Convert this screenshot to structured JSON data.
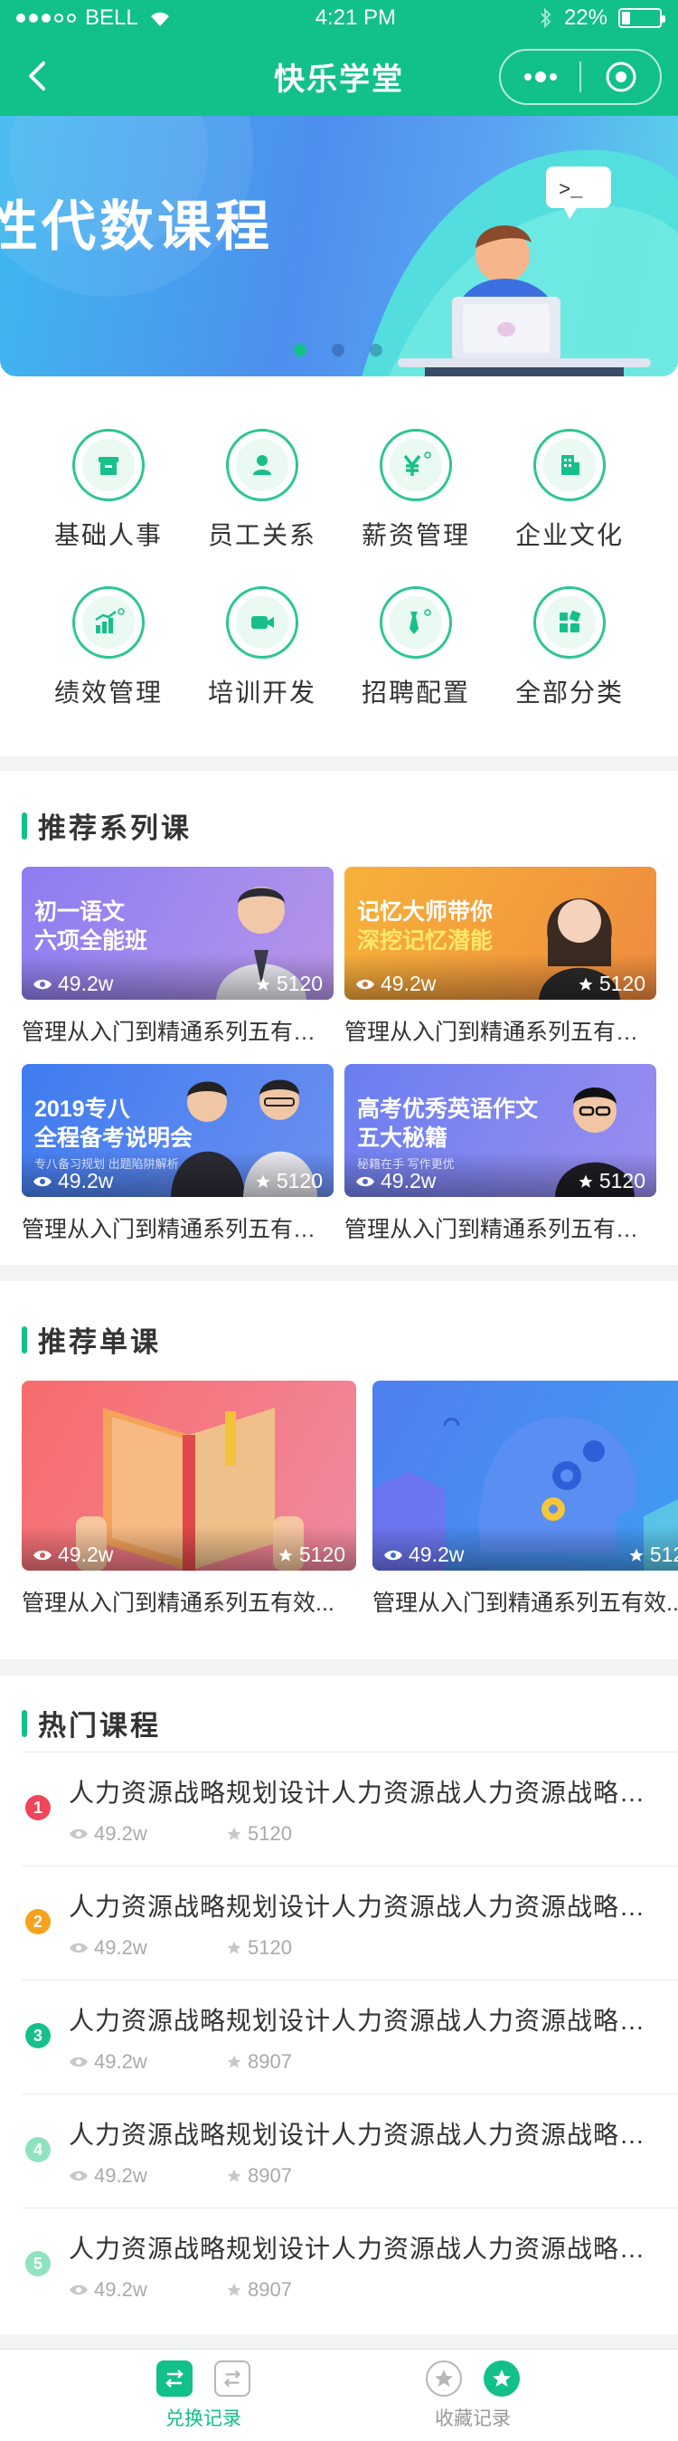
{
  "status_bar": {
    "carrier": "BELL",
    "time": "4:21 PM",
    "battery": "22%",
    "battery_level": 0.22
  },
  "nav": {
    "title": "快乐学堂"
  },
  "banner": {
    "text": "性代数课程",
    "slides": 3,
    "active_slide": 0,
    "terminal_prompt": ">_"
  },
  "categories": [
    {
      "label": "基础人事",
      "icon": "archive-icon"
    },
    {
      "label": "员工关系",
      "icon": "person-icon"
    },
    {
      "label": "薪资管理",
      "icon": "yen-icon"
    },
    {
      "label": "企业文化",
      "icon": "building-icon"
    },
    {
      "label": "绩效管理",
      "icon": "chart-icon"
    },
    {
      "label": "培训开发",
      "icon": "video-icon"
    },
    {
      "label": "招聘配置",
      "icon": "tie-icon"
    },
    {
      "label": "全部分类",
      "icon": "grid-icon"
    }
  ],
  "series": {
    "title": "推荐系列课",
    "items": [
      {
        "title_line1": "初一语文",
        "title_line2": "六项全能班",
        "subtitle": "",
        "views": "49.2w",
        "rating": "5120",
        "caption": "管理从入门到精通系列五有效...",
        "bg": "#8a7cf0"
      },
      {
        "title_line1": "记忆大师带你",
        "title_line2": "深挖记忆潜能",
        "subtitle": "",
        "views": "49.2w",
        "rating": "5120",
        "caption": "管理从入门到精通系列五有效...",
        "bg": "#f2a03a"
      },
      {
        "title_line1": "2019专八",
        "title_line2": "全程备考说明会",
        "subtitle": "专八备习规划 出题陷阱解析",
        "views": "49.2w",
        "rating": "5120",
        "caption": "管理从入门到精通系列五有效...",
        "bg": "#4f7bef"
      },
      {
        "title_line1": "高考优秀英语作文",
        "title_line2": "五大秘籍",
        "subtitle": "秘籍在手 写作更优",
        "views": "49.2w",
        "rating": "5120",
        "caption": "管理从入门到精通系列五有效...",
        "bg": "#7a8ef2"
      }
    ]
  },
  "singles": {
    "title": "推荐单课",
    "items": [
      {
        "views": "49.2w",
        "rating": "5120",
        "caption": "管理从入门到精通系列五有效..."
      },
      {
        "views": "49.2w",
        "rating": "5120",
        "caption": "管理从入门到精通系列五有效..."
      }
    ]
  },
  "hot": {
    "title": "热门课程",
    "items": [
      {
        "rank": "1",
        "title": "人力资源战略规划设计人力资源战人力资源战略规划",
        "views": "49.2w",
        "rating": "5120",
        "color": "#f0455a"
      },
      {
        "rank": "2",
        "title": "人力资源战略规划设计人力资源战人力资源战略规划",
        "views": "49.2w",
        "rating": "5120",
        "color": "#f6a21c"
      },
      {
        "rank": "3",
        "title": "人力资源战略规划设计人力资源战人力资源战略规划",
        "views": "49.2w",
        "rating": "8907",
        "color": "#17c08a"
      },
      {
        "rank": "4",
        "title": "人力资源战略规划设计人力资源战人力资源战略规划",
        "views": "49.2w",
        "rating": "8907",
        "color": "#8fe3c0"
      },
      {
        "rank": "5",
        "title": "人力资源战略规划设计人力资源战人力资源战略规划",
        "views": "49.2w",
        "rating": "8907",
        "color": "#8fe3c0"
      }
    ]
  },
  "tabs": [
    {
      "label": "兑换记录",
      "active": true
    },
    {
      "label": "收藏记录",
      "active": false
    }
  ],
  "colors": {
    "brand": "#12c08a",
    "text": "#333333",
    "muted": "#aaaaaa"
  }
}
